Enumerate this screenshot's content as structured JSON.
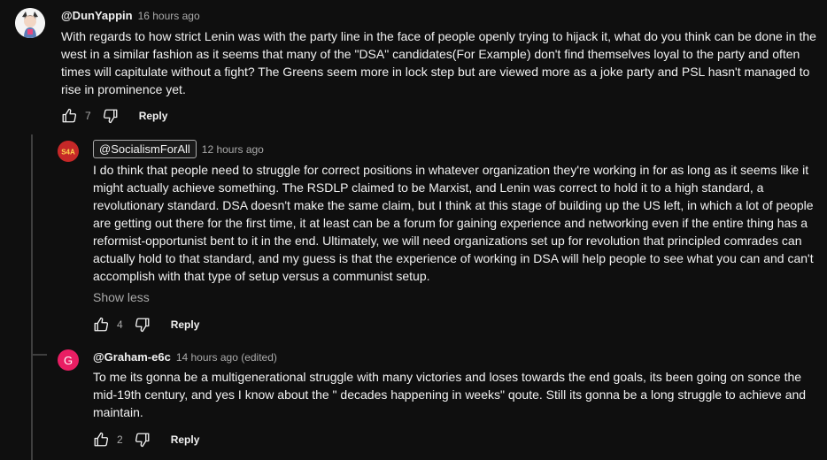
{
  "comments": [
    {
      "author": "@DunYappin",
      "time": "16 hours ago",
      "text": "With regards to how strict Lenin was with the party line in the face of people openly trying to hijack it, what do you think can be done in the west in a similar fashion as it seems that many of the \"DSA\" candidates(For Example) don't find themselves loyal to the party and often times will capitulate without a fight? The Greens seem more in lock step but are viewed more as a joke party and PSL hasn't managed to rise in prominence yet.",
      "likes": "7",
      "reply_label": "Reply"
    },
    {
      "author": "@SocialismForAll",
      "avatar_text": "S4A",
      "time": "12 hours ago",
      "text": "I do think that people need to struggle for correct positions in whatever organization they're working in for as long as it seems like it might actually achieve something. The RSDLP claimed to be Marxist, and Lenin was correct to hold it to a high standard, a revolutionary standard. DSA doesn't make the same claim, but I think at this stage of building up the US left, in which a lot of people are getting out there for the first time, it at least can be a forum for gaining experience and networking even if the entire thing has a reformist-opportunist bent to it in the end. Ultimately, we will need organizations set up for revolution that principled comrades can actually hold to that standard, and my guess is that the experience of working in DSA will help people to see what you can and can't accomplish with that type of setup versus a communist setup.",
      "show_less": "Show less",
      "likes": "4",
      "reply_label": "Reply"
    },
    {
      "author": "@Graham-e6c",
      "avatar_letter": "G",
      "time": "14 hours ago (edited)",
      "text": "To me its gonna be a multigenerational struggle with many victories and loses towards the end goals, its been going on sonce the mid-19th century, and yes I know about the \" decades happening in weeks\" qoute. Still its gonna be a long struggle to achieve and maintain.",
      "likes": "2",
      "reply_label": "Reply"
    }
  ],
  "colors": {
    "background": "#0f0f0f",
    "text": "#f1f1f1",
    "muted": "#aaaaaa",
    "graham_avatar": "#e91e63",
    "s4a_avatar": "#c62828"
  },
  "icons": [
    "thumbs-up-icon",
    "thumbs-down-icon"
  ]
}
